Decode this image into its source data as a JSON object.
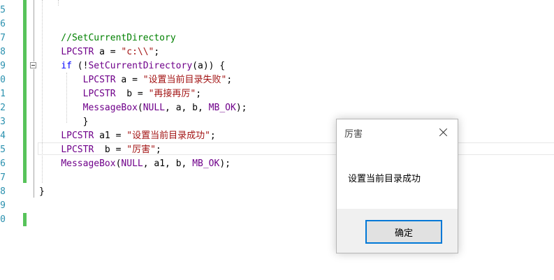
{
  "editor": {
    "lines": [
      {
        "no": "5",
        "tokens": []
      },
      {
        "no": "6",
        "tokens": []
      },
      {
        "no": "7",
        "tokens": [
          {
            "t": "    //SetCurrentDirectory",
            "c": "cmt"
          }
        ]
      },
      {
        "no": "8",
        "tokens": [
          {
            "t": "    ",
            "c": ""
          },
          {
            "t": "LPCSTR",
            "c": "ty"
          },
          {
            "t": " a = ",
            "c": ""
          },
          {
            "t": "\"c:\\\\\"",
            "c": "str"
          },
          {
            "t": ";",
            "c": ""
          }
        ]
      },
      {
        "no": "9",
        "tokens": [
          {
            "t": "    ",
            "c": ""
          },
          {
            "t": "if",
            "c": "kw"
          },
          {
            "t": " (!",
            "c": ""
          },
          {
            "t": "SetCurrentDirectory",
            "c": "fn"
          },
          {
            "t": "(a)) {",
            "c": ""
          }
        ]
      },
      {
        "no": "0",
        "tokens": [
          {
            "t": "        ",
            "c": ""
          },
          {
            "t": "LPCSTR",
            "c": "ty"
          },
          {
            "t": " a = ",
            "c": ""
          },
          {
            "t": "\"设置当前目录失败\"",
            "c": "str"
          },
          {
            "t": ";",
            "c": ""
          }
        ]
      },
      {
        "no": "1",
        "tokens": [
          {
            "t": "        ",
            "c": ""
          },
          {
            "t": "LPCSTR",
            "c": "ty"
          },
          {
            "t": "  b = ",
            "c": ""
          },
          {
            "t": "\"再接再厉\"",
            "c": "str"
          },
          {
            "t": ";",
            "c": ""
          }
        ]
      },
      {
        "no": "2",
        "tokens": [
          {
            "t": "        ",
            "c": ""
          },
          {
            "t": "MessageBox",
            "c": "fn"
          },
          {
            "t": "(",
            "c": ""
          },
          {
            "t": "NULL",
            "c": "ty"
          },
          {
            "t": ", a, b, ",
            "c": ""
          },
          {
            "t": "MB_OK",
            "c": "ty"
          },
          {
            "t": ");",
            "c": ""
          }
        ]
      },
      {
        "no": "3",
        "tokens": [
          {
            "t": "        }",
            "c": ""
          }
        ]
      },
      {
        "no": "4",
        "tokens": [
          {
            "t": "    ",
            "c": ""
          },
          {
            "t": "LPCSTR",
            "c": "ty"
          },
          {
            "t": " a1 = ",
            "c": ""
          },
          {
            "t": "\"设置当前目录成功\"",
            "c": "str"
          },
          {
            "t": ";",
            "c": ""
          }
        ]
      },
      {
        "no": "5",
        "tokens": [
          {
            "t": "    ",
            "c": ""
          },
          {
            "t": "LPCSTR",
            "c": "ty"
          },
          {
            "t": "  b = ",
            "c": ""
          },
          {
            "t": "\"厉害\"",
            "c": "str"
          },
          {
            "t": ";",
            "c": ""
          }
        ]
      },
      {
        "no": "6",
        "tokens": [
          {
            "t": "    ",
            "c": ""
          },
          {
            "t": "MessageBox",
            "c": "fn"
          },
          {
            "t": "(",
            "c": ""
          },
          {
            "t": "NULL",
            "c": "ty"
          },
          {
            "t": ", a1, b, ",
            "c": ""
          },
          {
            "t": "MB_OK",
            "c": "ty"
          },
          {
            "t": ");",
            "c": ""
          }
        ]
      },
      {
        "no": "7",
        "tokens": []
      },
      {
        "no": "8",
        "tokens": [
          {
            "t": "}",
            "c": ""
          }
        ]
      },
      {
        "no": "9",
        "tokens": []
      },
      {
        "no": "0",
        "tokens": []
      }
    ]
  },
  "dialog": {
    "title": "厉害",
    "message": "设置当前目录成功",
    "ok_label": "确定"
  }
}
